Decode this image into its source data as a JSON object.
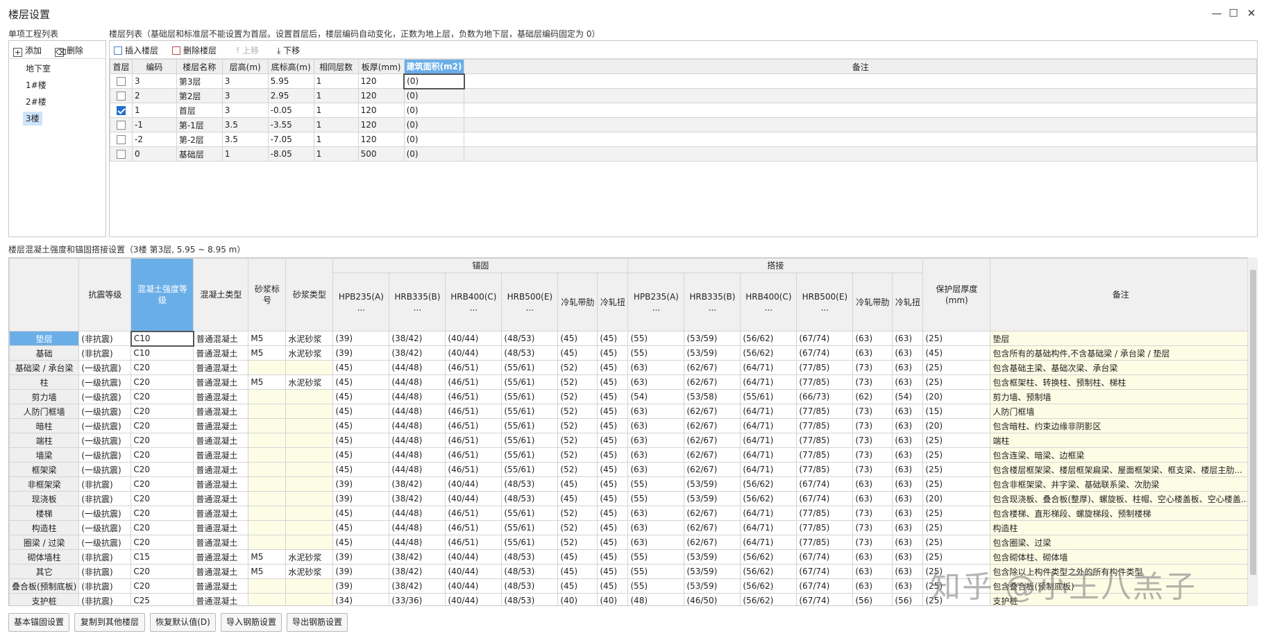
{
  "window": {
    "title": "楼层设置",
    "minimize": "—",
    "maximize": "☐",
    "close": "✕"
  },
  "project_panel": {
    "label": "单项工程列表",
    "add_label": "添加",
    "delete_label": "删除",
    "items": [
      "地下室",
      "1#楼",
      "2#楼",
      "3楼"
    ],
    "selected_index": 3
  },
  "floor_panel": {
    "label": "楼层列表（基础层和标准层不能设置为首层。设置首层后，楼层编码自动变化，正数为地上层，负数为地下层，基础层编码固定为 0）",
    "insert_label": "插入楼层",
    "delete_label": "删除楼层",
    "up_label": "上移",
    "down_label": "下移",
    "columns": [
      "首层",
      "编码",
      "楼层名称",
      "层高(m)",
      "底标高(m)",
      "相同层数",
      "板厚(mm)",
      "建筑面积(m2)",
      "备注"
    ],
    "rows": [
      {
        "first": false,
        "code": "3",
        "name": "第3层",
        "height": "3",
        "bottom": "5.95",
        "same": "1",
        "thick": "120",
        "area": "(0)",
        "note": ""
      },
      {
        "first": false,
        "code": "2",
        "name": "第2层",
        "height": "3",
        "bottom": "2.95",
        "same": "1",
        "thick": "120",
        "area": "(0)",
        "note": ""
      },
      {
        "first": true,
        "code": "1",
        "name": "首层",
        "height": "3",
        "bottom": "-0.05",
        "same": "1",
        "thick": "120",
        "area": "(0)",
        "note": ""
      },
      {
        "first": false,
        "code": "-1",
        "name": "第-1层",
        "height": "3.5",
        "bottom": "-3.55",
        "same": "1",
        "thick": "120",
        "area": "(0)",
        "note": ""
      },
      {
        "first": false,
        "code": "-2",
        "name": "第-2层",
        "height": "3.5",
        "bottom": "-7.05",
        "same": "1",
        "thick": "120",
        "area": "(0)",
        "note": ""
      },
      {
        "first": false,
        "code": "0",
        "name": "基础层",
        "height": "1",
        "bottom": "-8.05",
        "same": "1",
        "thick": "500",
        "area": "(0)",
        "note": ""
      }
    ]
  },
  "anchor_section": {
    "label": "楼层混凝土强度和锚固搭接设置（3楼 第3层, 5.95 ~ 8.95 m）",
    "group_anchor": "锚固",
    "group_lap": "搭接",
    "columns": [
      "抗震等级",
      "混凝土强度等级",
      "混凝土类型",
      "砂浆标号",
      "砂浆类型",
      "HPB235(A)\n...",
      "HRB335(B)\n...",
      "HRB400(C)\n...",
      "HRB500(E)\n...",
      "冷轧带肋",
      "冷轧扭",
      "HPB235(A)\n...",
      "HRB335(B)\n...",
      "HRB400(C)\n...",
      "HRB500(E)\n...",
      "冷轧带肋",
      "冷轧扭",
      "保护层厚度(mm)",
      "备注"
    ],
    "rows": [
      [
        "垫层",
        "(非抗震)",
        "C10",
        "普通混凝土",
        "M5",
        "水泥砂浆",
        "(39)",
        "(38/42)",
        "(40/44)",
        "(48/53)",
        "(45)",
        "(45)",
        "(55)",
        "(53/59)",
        "(56/62)",
        "(67/74)",
        "(63)",
        "(63)",
        "(25)",
        "垫层"
      ],
      [
        "基础",
        "(非抗震)",
        "C10",
        "普通混凝土",
        "M5",
        "水泥砂浆",
        "(39)",
        "(38/42)",
        "(40/44)",
        "(48/53)",
        "(45)",
        "(45)",
        "(55)",
        "(53/59)",
        "(56/62)",
        "(67/74)",
        "(63)",
        "(63)",
        "(45)",
        "包含所有的基础构件,不含基础梁 / 承台梁 / 垫层"
      ],
      [
        "基础梁 / 承台梁",
        "(一级抗震)",
        "C20",
        "普通混凝土",
        "",
        "",
        "(45)",
        "(44/48)",
        "(46/51)",
        "(55/61)",
        "(52)",
        "(45)",
        "(63)",
        "(62/67)",
        "(64/71)",
        "(77/85)",
        "(73)",
        "(63)",
        "(25)",
        "包含基础主梁、基础次梁、承台梁"
      ],
      [
        "柱",
        "(一级抗震)",
        "C20",
        "普通混凝土",
        "M5",
        "水泥砂浆",
        "(45)",
        "(44/48)",
        "(46/51)",
        "(55/61)",
        "(52)",
        "(45)",
        "(63)",
        "(62/67)",
        "(64/71)",
        "(77/85)",
        "(73)",
        "(63)",
        "(25)",
        "包含框架柱、转换柱、预制柱、梯柱"
      ],
      [
        "剪力墙",
        "(一级抗震)",
        "C20",
        "普通混凝土",
        "",
        "",
        "(45)",
        "(44/48)",
        "(46/51)",
        "(55/61)",
        "(52)",
        "(45)",
        "(54)",
        "(53/58)",
        "(55/61)",
        "(66/73)",
        "(62)",
        "(54)",
        "(20)",
        "剪力墙、预制墙"
      ],
      [
        "人防门框墙",
        "(一级抗震)",
        "C20",
        "普通混凝土",
        "",
        "",
        "(45)",
        "(44/48)",
        "(46/51)",
        "(55/61)",
        "(52)",
        "(45)",
        "(63)",
        "(62/67)",
        "(64/71)",
        "(77/85)",
        "(73)",
        "(63)",
        "(15)",
        "人防门框墙"
      ],
      [
        "暗柱",
        "(一级抗震)",
        "C20",
        "普通混凝土",
        "",
        "",
        "(45)",
        "(44/48)",
        "(46/51)",
        "(55/61)",
        "(52)",
        "(45)",
        "(63)",
        "(62/67)",
        "(64/71)",
        "(77/85)",
        "(73)",
        "(63)",
        "(20)",
        "包含暗柱、约束边缘非阴影区"
      ],
      [
        "端柱",
        "(一级抗震)",
        "C20",
        "普通混凝土",
        "",
        "",
        "(45)",
        "(44/48)",
        "(46/51)",
        "(55/61)",
        "(52)",
        "(45)",
        "(63)",
        "(62/67)",
        "(64/71)",
        "(77/85)",
        "(73)",
        "(63)",
        "(25)",
        "端柱"
      ],
      [
        "墙梁",
        "(一级抗震)",
        "C20",
        "普通混凝土",
        "",
        "",
        "(45)",
        "(44/48)",
        "(46/51)",
        "(55/61)",
        "(52)",
        "(45)",
        "(63)",
        "(62/67)",
        "(64/71)",
        "(77/85)",
        "(73)",
        "(63)",
        "(25)",
        "包含连梁、暗梁、边框梁"
      ],
      [
        "框架梁",
        "(一级抗震)",
        "C20",
        "普通混凝土",
        "",
        "",
        "(45)",
        "(44/48)",
        "(46/51)",
        "(55/61)",
        "(52)",
        "(45)",
        "(63)",
        "(62/67)",
        "(64/71)",
        "(77/85)",
        "(73)",
        "(63)",
        "(25)",
        "包含楼层框架梁、楼层框架扁梁、屋面框架梁、框支梁、楼层主肋..."
      ],
      [
        "非框架梁",
        "(非抗震)",
        "C20",
        "普通混凝土",
        "",
        "",
        "(39)",
        "(38/42)",
        "(40/44)",
        "(48/53)",
        "(45)",
        "(45)",
        "(55)",
        "(53/59)",
        "(56/62)",
        "(67/74)",
        "(63)",
        "(63)",
        "(25)",
        "包含非框架梁、井字梁、基础联系梁、次肋梁"
      ],
      [
        "现浇板",
        "(非抗震)",
        "C20",
        "普通混凝土",
        "",
        "",
        "(39)",
        "(38/42)",
        "(40/44)",
        "(48/53)",
        "(45)",
        "(45)",
        "(55)",
        "(53/59)",
        "(56/62)",
        "(67/74)",
        "(63)",
        "(63)",
        "(20)",
        "包含现浇板、叠合板(整厚)、螺旋板、柱帽、空心楼盖板、空心楼盖..."
      ],
      [
        "楼梯",
        "(一级抗震)",
        "C20",
        "普通混凝土",
        "",
        "",
        "(45)",
        "(44/48)",
        "(46/51)",
        "(55/61)",
        "(52)",
        "(45)",
        "(63)",
        "(62/67)",
        "(64/71)",
        "(77/85)",
        "(73)",
        "(63)",
        "(25)",
        "包含楼梯、直形梯段、螺旋梯段、预制楼梯"
      ],
      [
        "构造柱",
        "(一级抗震)",
        "C20",
        "普通混凝土",
        "",
        "",
        "(45)",
        "(44/48)",
        "(46/51)",
        "(55/61)",
        "(52)",
        "(45)",
        "(63)",
        "(62/67)",
        "(64/71)",
        "(77/85)",
        "(73)",
        "(63)",
        "(25)",
        "构造柱"
      ],
      [
        "圈梁 / 过梁",
        "(一级抗震)",
        "C20",
        "普通混凝土",
        "",
        "",
        "(45)",
        "(44/48)",
        "(46/51)",
        "(55/61)",
        "(52)",
        "(45)",
        "(63)",
        "(62/67)",
        "(64/71)",
        "(77/85)",
        "(73)",
        "(63)",
        "(25)",
        "包含圈梁、过梁"
      ],
      [
        "砌体墙柱",
        "(非抗震)",
        "C15",
        "普通混凝土",
        "M5",
        "水泥砂浆",
        "(39)",
        "(38/42)",
        "(40/44)",
        "(48/53)",
        "(45)",
        "(45)",
        "(55)",
        "(53/59)",
        "(56/62)",
        "(67/74)",
        "(63)",
        "(63)",
        "(25)",
        "包含砌体柱、砌体墙"
      ],
      [
        "其它",
        "(非抗震)",
        "C20",
        "普通混凝土",
        "M5",
        "水泥砂浆",
        "(39)",
        "(38/42)",
        "(40/44)",
        "(48/53)",
        "(45)",
        "(45)",
        "(55)",
        "(53/59)",
        "(56/62)",
        "(67/74)",
        "(63)",
        "(63)",
        "(25)",
        "包含除以上构件类型之外的所有构件类型"
      ],
      [
        "叠合板(预制底板)",
        "(非抗震)",
        "C20",
        "普通混凝土",
        "",
        "",
        "(39)",
        "(38/42)",
        "(40/44)",
        "(48/53)",
        "(45)",
        "(45)",
        "(55)",
        "(53/59)",
        "(56/62)",
        "(67/74)",
        "(63)",
        "(63)",
        "(25)",
        "包含叠合板(预制底板)"
      ],
      [
        "支护桩",
        "(非抗震)",
        "C25",
        "普通混凝土",
        "",
        "",
        "(34)",
        "(33/36)",
        "(40/44)",
        "(48/53)",
        "(40)",
        "(40)",
        "(48)",
        "(46/50)",
        "(56/62)",
        "(67/74)",
        "(56)",
        "(56)",
        "(25)",
        "支护桩"
      ]
    ]
  },
  "bottom_buttons": [
    "基本锚固设置",
    "复制到其他楼层",
    "恢复默认值(D)",
    "导入钢筋设置",
    "导出钢筋设置"
  ],
  "watermark": "知乎 @小王八羔子",
  "colors": {
    "header_highlight": "#6aaee8",
    "editable_cell": "#fdfde6",
    "check_on": "#1e6fd0"
  }
}
